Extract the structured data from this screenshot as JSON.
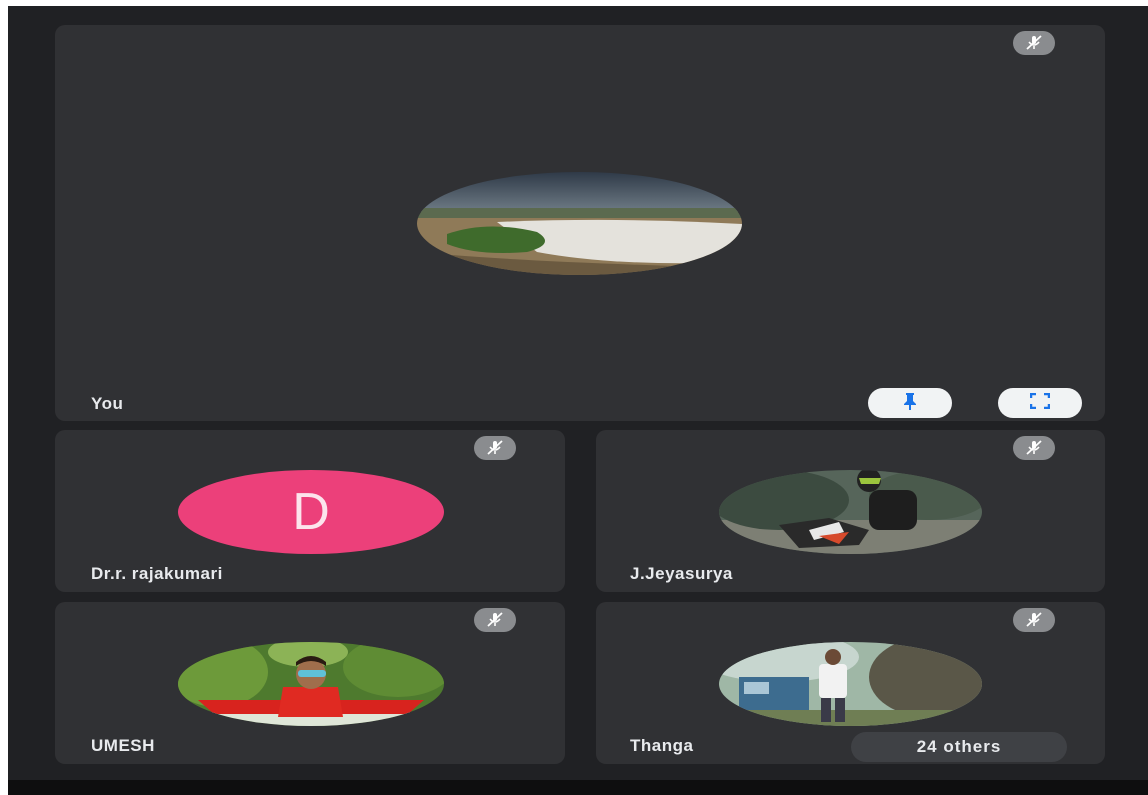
{
  "main_tile": {
    "name": "You"
  },
  "participants": [
    {
      "name": "Dr.r. rajakumari",
      "initial": "D",
      "avatar_color": "#ec407a"
    },
    {
      "name": "J.Jeyasurya"
    },
    {
      "name": "UMESH"
    },
    {
      "name": "Thanga"
    }
  ],
  "others_label": "24 others",
  "icons": {
    "mute": "mic-off-icon",
    "pin": "pin-icon",
    "fullscreen": "fullscreen-icon"
  },
  "colors": {
    "background": "#202124",
    "tile": "#303134",
    "accent_blue": "#1a73e8"
  }
}
